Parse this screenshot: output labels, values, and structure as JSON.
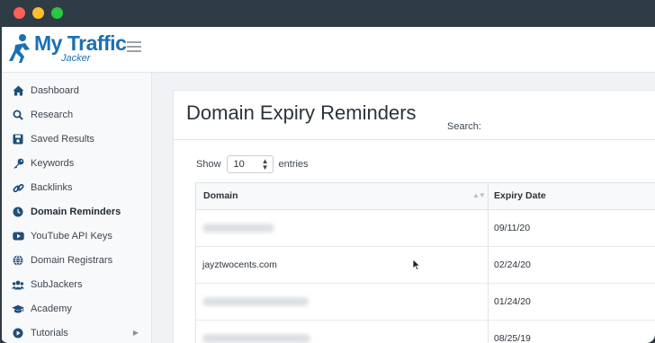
{
  "app": {
    "logo_main": "My Traffic",
    "logo_sub": "Jacker"
  },
  "sidebar": {
    "items": [
      {
        "label": "Dashboard",
        "icon": "home-icon"
      },
      {
        "label": "Research",
        "icon": "search-icon"
      },
      {
        "label": "Saved Results",
        "icon": "save-icon"
      },
      {
        "label": "Keywords",
        "icon": "key-icon"
      },
      {
        "label": "Backlinks",
        "icon": "link-icon"
      },
      {
        "label": "Domain Reminders",
        "icon": "clock-icon",
        "active": true
      },
      {
        "label": "YouTube API Keys",
        "icon": "youtube-icon"
      },
      {
        "label": "Domain Registrars",
        "icon": "globe-icon"
      },
      {
        "label": "SubJackers",
        "icon": "users-icon"
      },
      {
        "label": "Academy",
        "icon": "graduation-cap-icon"
      },
      {
        "label": "Tutorials",
        "icon": "play-icon",
        "has_submenu": true
      }
    ]
  },
  "main": {
    "title": "Domain Expiry Reminders",
    "show_label": "Show",
    "entries_value": "10",
    "entries_label": "entries",
    "search_label": "Search:",
    "table": {
      "headers": [
        "Domain",
        "Expiry Date"
      ],
      "rows": [
        {
          "domain": "",
          "domain_obscured": true,
          "expiry": "09/11/20"
        },
        {
          "domain": "jayztwocents.com",
          "domain_obscured": false,
          "expiry": "02/24/20"
        },
        {
          "domain": "",
          "domain_obscured": true,
          "expiry": "01/24/20"
        },
        {
          "domain": "",
          "domain_obscured": true,
          "expiry": "08/25/19"
        }
      ]
    }
  },
  "colors": {
    "brand": "#1b6fb3",
    "window_chrome": "#2f3b45"
  }
}
